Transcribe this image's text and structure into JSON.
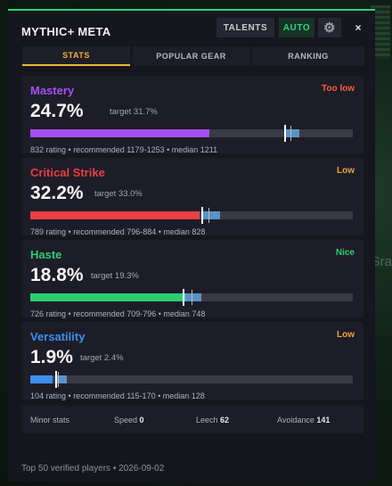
{
  "background": {
    "side_text": "Sra"
  },
  "header": {
    "title": "MYTHIC+ META",
    "talents_label": "TALENTS",
    "auto_label": "AUTO",
    "gear_icon": "gear-icon",
    "close_label": "×"
  },
  "tabs": [
    {
      "label": "STATS",
      "active": true
    },
    {
      "label": "POPULAR GEAR",
      "active": false
    },
    {
      "label": "RANKING",
      "active": false
    }
  ],
  "stats": [
    {
      "name": "Mastery",
      "status": "Too low",
      "percent": "24.7%",
      "target": "target 31.7%",
      "rating": "832 rating",
      "recommended": "recommended 1179-1253",
      "median": "median 1211",
      "color": "#a64ff0",
      "status_color": "#ff5b45",
      "current_value": 832,
      "range_min": 1179,
      "range_max": 1253,
      "median_value": 1211,
      "bar_max": 1500
    },
    {
      "name": "Critical Strike",
      "status": "Low",
      "percent": "32.2%",
      "target": "target 33.0%",
      "rating": "789 rating",
      "recommended": "recommended 796-884",
      "median": "median 828",
      "color": "#e83f44",
      "status_color": "#f0a23c",
      "current_value": 789,
      "range_min": 796,
      "range_max": 884,
      "median_value": 828,
      "bar_max": 1500
    },
    {
      "name": "Haste",
      "status": "Nice",
      "percent": "18.8%",
      "target": "target 19.3%",
      "rating": "726 rating",
      "recommended": "recommended 709-796",
      "median": "median 748",
      "color": "#2ecc71",
      "status_color": "#2ecc71",
      "current_value": 726,
      "range_min": 709,
      "range_max": 796,
      "median_value": 748,
      "bar_max": 1500
    },
    {
      "name": "Versatility",
      "status": "Low",
      "percent": "1.9%",
      "target": "target 2.4%",
      "rating": "104 rating",
      "recommended": "recommended 115-170",
      "median": "median 128",
      "color": "#3d8ff0",
      "status_color": "#f0a23c",
      "current_value": 104,
      "range_min": 115,
      "range_max": 170,
      "median_value": 128,
      "bar_max": 1500
    }
  ],
  "minor": {
    "label": "Minor stats",
    "speed_label": "Speed",
    "speed_value": "0",
    "leech_label": "Leech",
    "leech_value": "62",
    "avoidance_label": "Avoidance",
    "avoidance_value": "141"
  },
  "footer": {
    "text": "Top 50 verified players",
    "date": "2026-09-02"
  }
}
